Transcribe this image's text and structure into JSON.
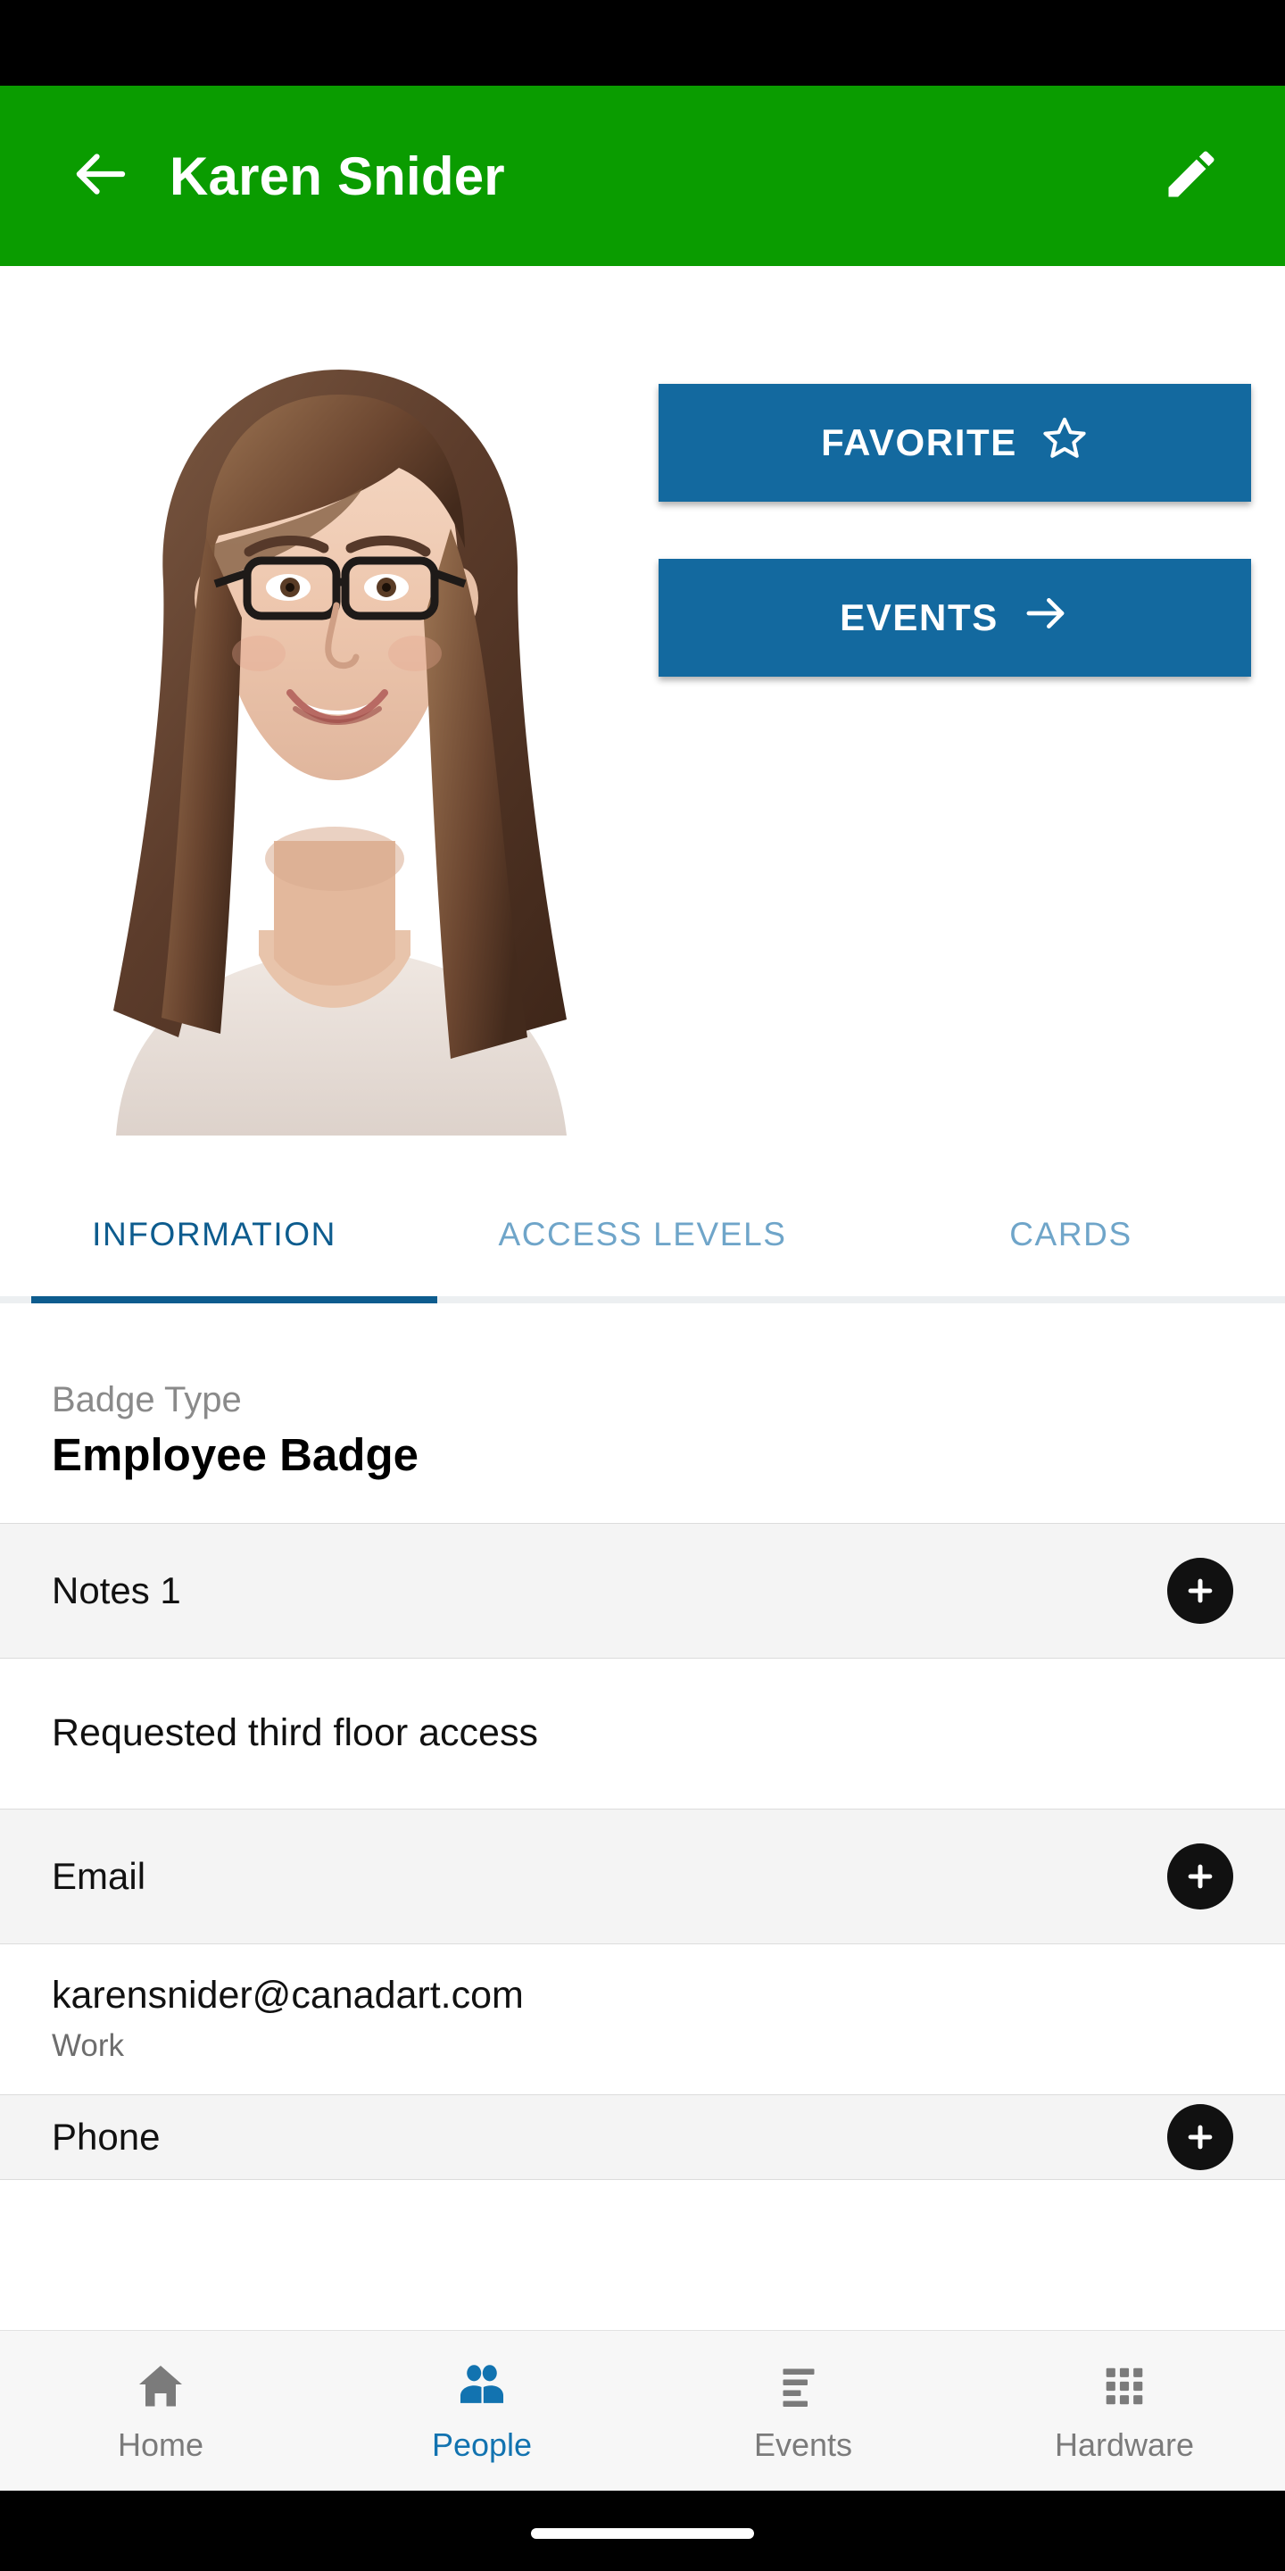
{
  "app_bar": {
    "back_icon": "arrow-left-icon",
    "title": "Karen Snider",
    "edit_icon": "pencil-edit-icon",
    "background_color": "#0a9c00"
  },
  "hero": {
    "photo_alt": "person-photo",
    "actions": [
      {
        "label": "FAVORITE",
        "icon": "star-outline-icon",
        "color": "#13699f"
      },
      {
        "label": "EVENTS",
        "icon": "arrow-right-icon",
        "color": "#13699f"
      }
    ]
  },
  "tabs": {
    "active_index": 0,
    "active_color": "#0d5c8e",
    "inactive_color": "#6fa5c9",
    "items": [
      {
        "label": "INFORMATION"
      },
      {
        "label": "ACCESS LEVELS"
      },
      {
        "label": "CARDS"
      }
    ]
  },
  "content": {
    "badge": {
      "label": "Badge Type",
      "value": "Employee Badge"
    },
    "notes_section": {
      "title": "Notes 1",
      "add_icon": "plus-icon"
    },
    "note": {
      "text": "Requested third floor access"
    },
    "email_section": {
      "title": "Email",
      "add_icon": "plus-icon"
    },
    "email": {
      "address": "karensnider@canadart.com",
      "type": "Work"
    },
    "phone_section": {
      "title": "Phone",
      "add_icon": "plus-icon"
    }
  },
  "bottom_nav": {
    "active_index": 1,
    "active_color": "#1273b0",
    "inactive_color": "#7b7b7b",
    "items": [
      {
        "label": "Home",
        "icon": "home-icon"
      },
      {
        "label": "People",
        "icon": "people-icon"
      },
      {
        "label": "Events",
        "icon": "list-icon"
      },
      {
        "label": "Hardware",
        "icon": "grid-icon"
      }
    ]
  }
}
